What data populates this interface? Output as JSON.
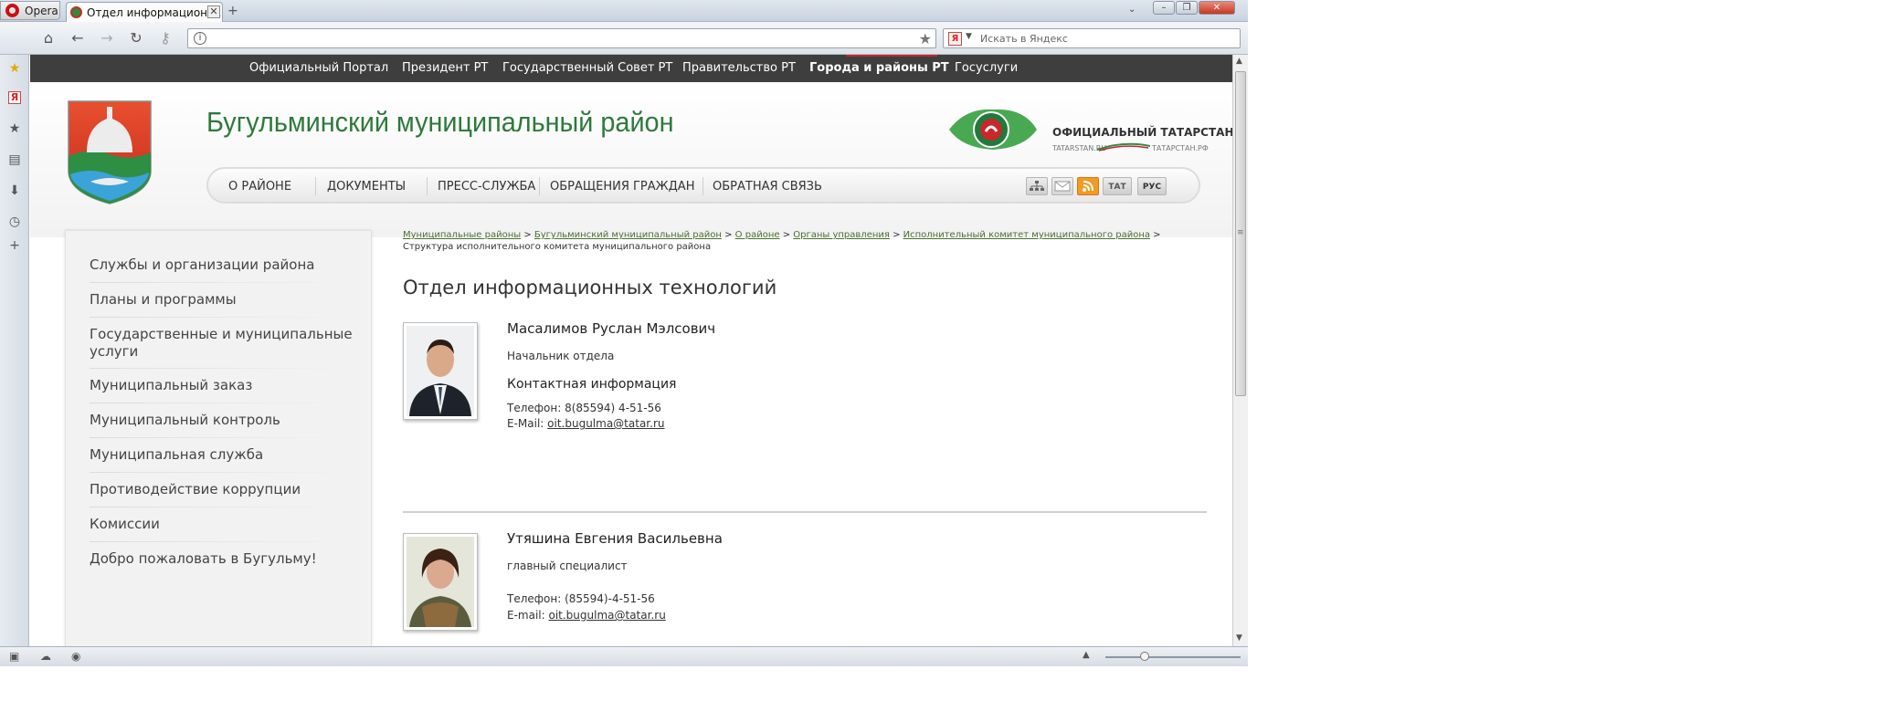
{
  "browser": {
    "menu_label": "Opera",
    "tab_title": "Отдел информационн...",
    "tab_close": "✕",
    "win_min": "–",
    "win_max": "❐",
    "win_close": "✕",
    "nav_icons": [
      "home-icon",
      "back-icon",
      "forward-icon",
      "reload-icon",
      "key-icon"
    ],
    "address_value": "",
    "search_engine": "Я",
    "search_placeholder": "Искать в Яндекс"
  },
  "sidebar_panel": {
    "icons": [
      "bookmarks-icon",
      "yandex-icon",
      "star-icon",
      "notes-icon",
      "downloads-icon",
      "history-icon",
      "plus-icon"
    ]
  },
  "topnav": {
    "items": [
      "Официальный Портал",
      "Президент РТ",
      "Государственный Совет РТ",
      "Правительство РТ",
      "Города и районы РТ",
      "Госуслуги"
    ],
    "active": "Города и районы РТ"
  },
  "header": {
    "title": "Бугульминский муниципальный район",
    "tat_title": "ОФИЦИАЛЬНЫЙ ТАТАРСТАН",
    "tat_sub1": "TATARSTAN.RU",
    "tat_sub2": "ТАТАРСТАН.РФ"
  },
  "mainnav": {
    "items": [
      "О РАЙОНЕ",
      "ДОКУМЕНТЫ",
      "ПРЕСС-СЛУЖБА",
      "ОБРАЩЕНИЯ ГРАЖДАН",
      "ОБРАТНАЯ СВЯЗЬ"
    ],
    "lang_tat": "ТАТ",
    "lang_rus": "РУС"
  },
  "leftmenu": {
    "items": [
      "Службы и организации района",
      "Планы и программы",
      "Государственные и муниципальные услуги",
      "Муниципальный заказ",
      "Муниципальный контроль",
      "Муниципальная служба",
      "Противодействие коррупции",
      "Комиссии",
      "Добро пожаловать в Бугульму!"
    ]
  },
  "breadcrumb": {
    "links": [
      "Муниципальные районы",
      "Бугульминский муниципальный район",
      "О районе",
      "Органы управления",
      "Исполнительный комитет муниципального района"
    ],
    "sep": " > ",
    "current": "Структура исполнительного комитета муниципального района"
  },
  "page": {
    "title": "Отдел информационных технологий"
  },
  "people": [
    {
      "name": "Масалимов Руслан Мэлсович",
      "position": "Начальник отдела",
      "contact_header": "Контактная информация",
      "phone": "Телефон: 8(85594) 4-51-56",
      "email_label": "E-Mail: ",
      "email": "oit.bugulma@tatar.ru"
    },
    {
      "name": "Утяшина Евгения Васильевна",
      "position": "главный специалист",
      "phone": "Телефон: (85594)-4-51-56",
      "email_label": "E-mail: ",
      "email": "oit.bugulma@tatar.ru"
    }
  ],
  "colors": {
    "topnav_bg": "#3e3e3e",
    "title_green": "#2d7a3a",
    "link_green": "#4a6e2e",
    "accent_red": "#c4262b"
  }
}
